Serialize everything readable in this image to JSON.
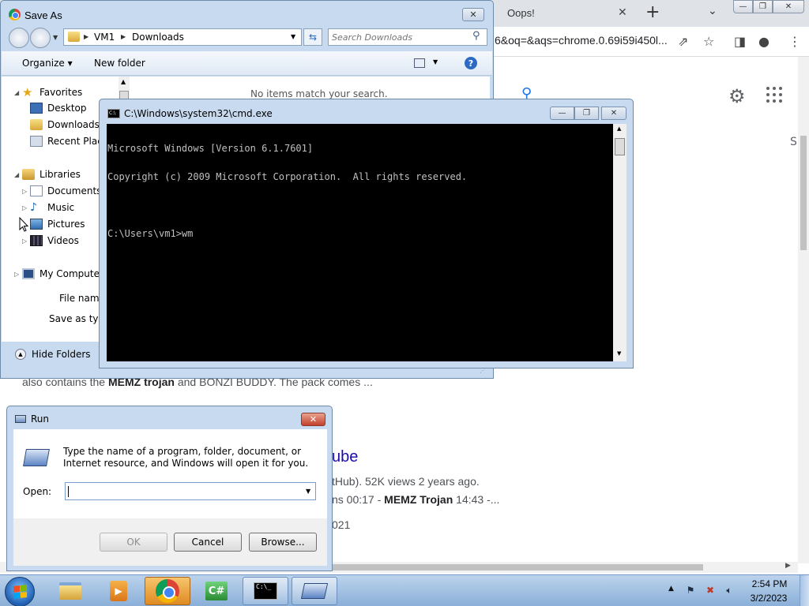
{
  "chrome": {
    "tab_title": "Oops!",
    "tab_close": "✕",
    "new_tab": "+",
    "tab_search": "⌄",
    "url_fragment": "6&oq=&aqs=chrome.0.69i59i450l...",
    "min": "—",
    "max": "❐",
    "close": "✕",
    "result_snippet_1": "also contains the ",
    "result_snippet_1_bold": "MEMZ trojan",
    "result_snippet_1_rest": " and BONZI BUDDY. The pack comes ...",
    "result_title_fragment": "ube",
    "result_meta": "tHub). 52K views 2 years ago.",
    "result_chapters_pre": "ns 00:17 - ",
    "result_chapters_bold": "MEMZ Trojan",
    "result_chapters_post": " 14:43 -...",
    "result_date_fragment": "021",
    "s_letter": "S"
  },
  "saveas": {
    "title": "Save As",
    "close": "✕",
    "breadcrumb": [
      "VM1",
      "Downloads"
    ],
    "search_placeholder": "Search Downloads",
    "organize": "Organize ▾",
    "new_folder": "New folder",
    "help": "?",
    "no_items": "No items match your search.",
    "nav": {
      "favorites": "Favorites",
      "desktop": "Desktop",
      "downloads": "Downloads",
      "recent": "Recent Places",
      "libraries": "Libraries",
      "documents": "Documents",
      "music": "Music",
      "pictures": "Pictures",
      "videos": "Videos",
      "computer": "My Computer"
    },
    "file_name_label": "File name:",
    "save_type_label": "Save as type:",
    "hide_folders": "Hide Folders"
  },
  "cmd": {
    "title": "C:\\Windows\\system32\\cmd.exe",
    "lines": [
      "Microsoft Windows [Version 6.1.7601]",
      "Copyright (c) 2009 Microsoft Corporation.  All rights reserved.",
      "",
      "C:\\Users\\vm1>wm"
    ],
    "min": "—",
    "max": "❐",
    "close": "✕"
  },
  "run": {
    "title": "Run",
    "close": "✕",
    "description": "Type the name of a program, folder, document, or Internet resource, and Windows will open it for you.",
    "open_label": "Open:",
    "open_value": "",
    "ok": "OK",
    "cancel": "Cancel",
    "browse": "Browse..."
  },
  "taskbar": {
    "time": "2:54 PM",
    "date": "3/2/2023",
    "csharp_label": "C#",
    "cmd_label": "C:\\_"
  }
}
